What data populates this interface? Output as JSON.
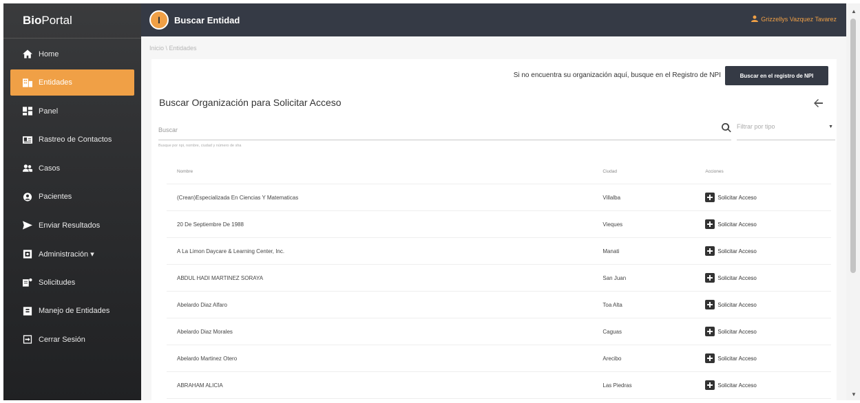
{
  "brand": {
    "bold": "Bio",
    "regular": "Portal"
  },
  "sidebar": {
    "items": [
      {
        "label": "Home",
        "icon": "home-icon"
      },
      {
        "label": "Entidades",
        "icon": "building-icon",
        "active": true
      },
      {
        "label": "Panel",
        "icon": "dashboard-icon"
      },
      {
        "label": "Rastreo de Contactos",
        "icon": "id-card-icon"
      },
      {
        "label": "Casos",
        "icon": "people-icon"
      },
      {
        "label": "Pacientes",
        "icon": "patient-icon"
      },
      {
        "label": "Enviar Resultados",
        "icon": "send-icon"
      },
      {
        "label": "Administración ▾",
        "icon": "admin-icon"
      },
      {
        "label": "Solicitudes",
        "icon": "requests-icon"
      },
      {
        "label": "Manejo de Entidades",
        "icon": "entity-icon"
      },
      {
        "label": "Cerrar Sesión",
        "icon": "logout-icon"
      }
    ]
  },
  "topbar": {
    "logo_letter": "I",
    "title": "Buscar Entidad",
    "user": "Grizzellys Vazquez Tavarez"
  },
  "breadcrumb": "Inicio \\ Entidades",
  "npi": {
    "text": "Si no encuentra su organización aquí, busque en el Registro de NPI",
    "button": "Buscar en el registro de NPI"
  },
  "title": "Buscar Organización para Solicitar Acceso",
  "search": {
    "placeholder": "Buscar",
    "help": "Busque por npi, nombre, ciudad y número de sha"
  },
  "filter": {
    "placeholder": "Filtrar por tipo"
  },
  "table": {
    "headers": [
      "Nombre",
      "Ciudad",
      "Acciones"
    ],
    "action_label": "Solicitar Acceso",
    "rows": [
      {
        "name": "(Crean)Especializada En Ciencias Y Matematicas",
        "city": "Villalba"
      },
      {
        "name": "20 De Septiembre De 1988",
        "city": "Vieques"
      },
      {
        "name": "A La Limon Daycare & Learning Center, Inc.",
        "city": "Manati"
      },
      {
        "name": "ABDUL HADI MARTINEZ SORAYA",
        "city": "San Juan"
      },
      {
        "name": "Abelardo Diaz Alfaro",
        "city": "Toa Alta"
      },
      {
        "name": "Abelardo Diaz Morales",
        "city": "Caguas"
      },
      {
        "name": "Abelardo Martinez Otero",
        "city": "Arecibo"
      },
      {
        "name": "ABRAHAM ALICIA",
        "city": "Las Piedras"
      }
    ]
  }
}
